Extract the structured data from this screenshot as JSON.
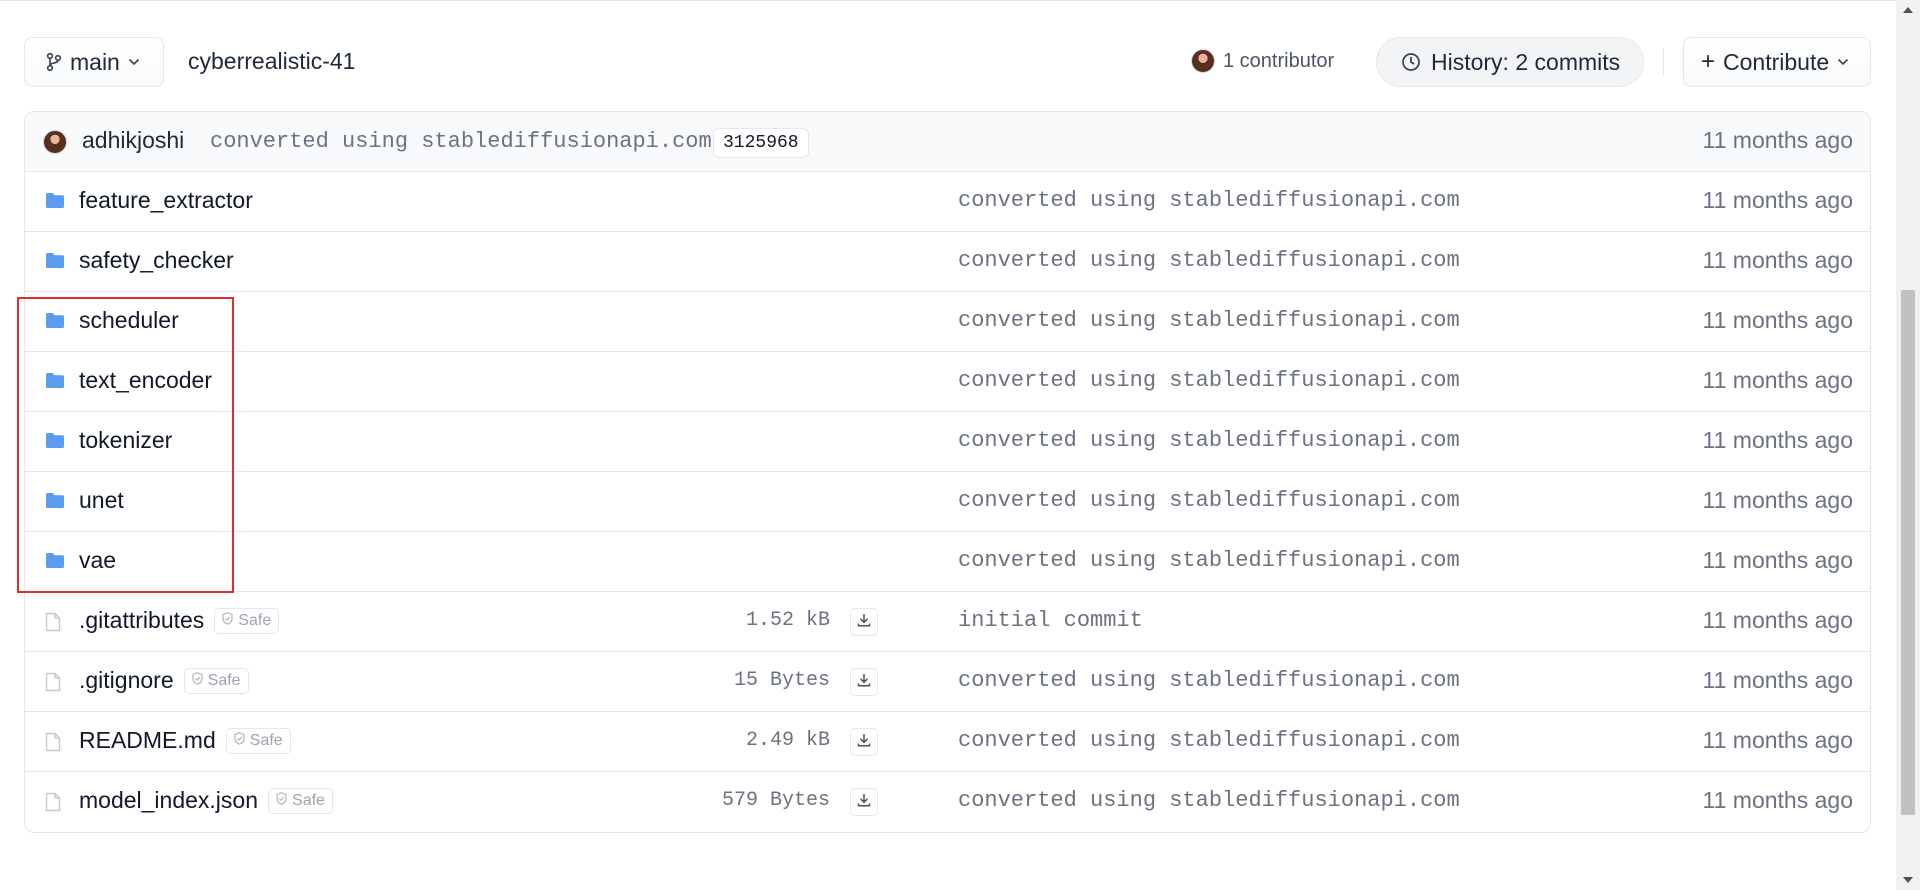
{
  "header": {
    "branch": "main",
    "repo_name": "cyberrealistic-41",
    "contributors": "1 contributor",
    "history": "History: 2 commits",
    "contribute": "Contribute"
  },
  "last_commit": {
    "author": "adhikjoshi",
    "message": "converted using stablediffusionapi.com",
    "hash": "3125968",
    "time": "11 months ago"
  },
  "files": [
    {
      "name": "feature_extractor",
      "type": "folder",
      "message": "converted using stablediffusionapi.com",
      "time": "11 months ago"
    },
    {
      "name": "safety_checker",
      "type": "folder",
      "message": "converted using stablediffusionapi.com",
      "time": "11 months ago"
    },
    {
      "name": "scheduler",
      "type": "folder",
      "message": "converted using stablediffusionapi.com",
      "time": "11 months ago"
    },
    {
      "name": "text_encoder",
      "type": "folder",
      "message": "converted using stablediffusionapi.com",
      "time": "11 months ago"
    },
    {
      "name": "tokenizer",
      "type": "folder",
      "message": "converted using stablediffusionapi.com",
      "time": "11 months ago"
    },
    {
      "name": "unet",
      "type": "folder",
      "message": "converted using stablediffusionapi.com",
      "time": "11 months ago"
    },
    {
      "name": "vae",
      "type": "folder",
      "message": "converted using stablediffusionapi.com",
      "time": "11 months ago"
    },
    {
      "name": ".gitattributes",
      "type": "file",
      "badge": "Safe",
      "size": "1.52 kB",
      "message": "initial commit",
      "time": "11 months ago"
    },
    {
      "name": ".gitignore",
      "type": "file",
      "badge": "Safe",
      "size": "15 Bytes",
      "message": "converted using stablediffusionapi.com",
      "time": "11 months ago"
    },
    {
      "name": "README.md",
      "type": "file",
      "badge": "Safe",
      "size": "2.49 kB",
      "message": "converted using stablediffusionapi.com",
      "time": "11 months ago"
    },
    {
      "name": "model_index.json",
      "type": "file",
      "badge": "Safe",
      "size": "579 Bytes",
      "message": "converted using stablediffusionapi.com",
      "time": "11 months ago"
    }
  ],
  "colors": {
    "folder_icon": "#5a9cf0",
    "highlight_box": "#e02d2d",
    "muted_text": "#6b7280"
  }
}
